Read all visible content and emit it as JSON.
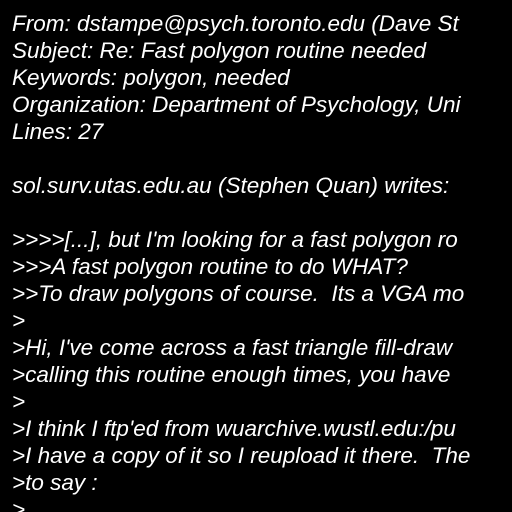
{
  "theme": {
    "background": "#000000",
    "text_color": "#ffffff"
  },
  "message": {
    "header": {
      "from": "From: dstampe@psych.toronto.edu (Dave St",
      "subject": "Subject: Re: Fast polygon routine needed",
      "keywords": "Keywords: polygon, needed",
      "organization": "Organization: Department of Psychology, Uni",
      "lines": "Lines: 27"
    },
    "attribution": "sol.surv.utas.edu.au (Stephen Quan) writes:",
    "body": [
      ">>>>[...], but I'm looking for a fast polygon ro",
      ">>>A fast polygon routine to do WHAT?",
      ">>To draw polygons of course.  Its a VGA mo",
      ">",
      ">Hi, I've come across a fast triangle fill-draw",
      ">calling this routine enough times, you have",
      ">",
      ">I think I ftp'ed from wuarchive.wustl.edu:/pu",
      ">I have a copy of it so I reupload it there.  The",
      ">to say :",
      ">"
    ]
  }
}
